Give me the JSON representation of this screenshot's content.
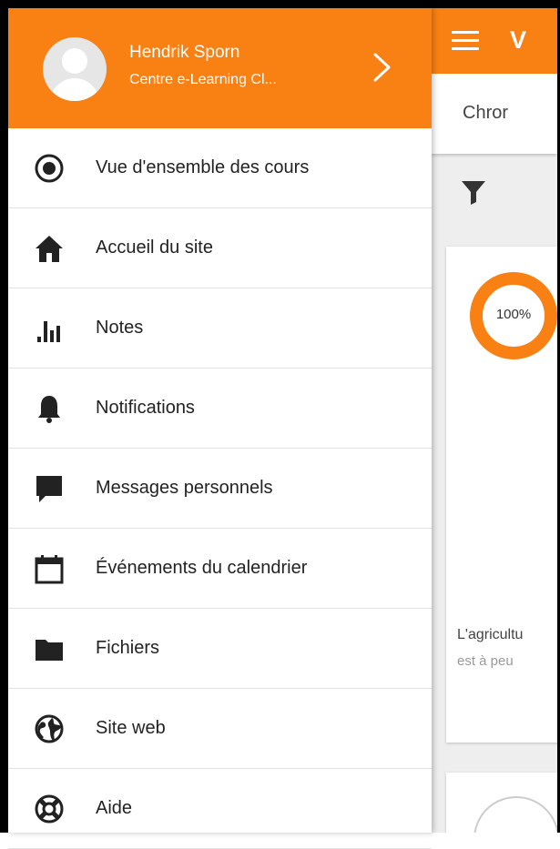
{
  "app": {
    "title_partial": "V",
    "tab_partial": "Chror",
    "course": {
      "progress": "100%",
      "title_partial": "L'agricultu",
      "subtitle_partial": "est à peu"
    }
  },
  "drawer": {
    "user": {
      "name": "Hendrik Sporn",
      "site": "Centre e-Learning Cl..."
    },
    "items": [
      {
        "label": "Vue d'ensemble des cours",
        "icon": "radio-target-icon"
      },
      {
        "label": "Accueil du site",
        "icon": "home-icon"
      },
      {
        "label": "Notes",
        "icon": "bar-chart-icon"
      },
      {
        "label": "Notifications",
        "icon": "bell-icon"
      },
      {
        "label": "Messages personnels",
        "icon": "chat-bubble-icon"
      },
      {
        "label": "Événements du calendrier",
        "icon": "calendar-icon"
      },
      {
        "label": "Fichiers",
        "icon": "folder-icon"
      },
      {
        "label": "Site web",
        "icon": "globe-icon"
      },
      {
        "label": "Aide",
        "icon": "lifebuoy-icon"
      }
    ]
  },
  "colors": {
    "accent": "#f98012",
    "background": "#eeeeee",
    "text": "#222222"
  }
}
